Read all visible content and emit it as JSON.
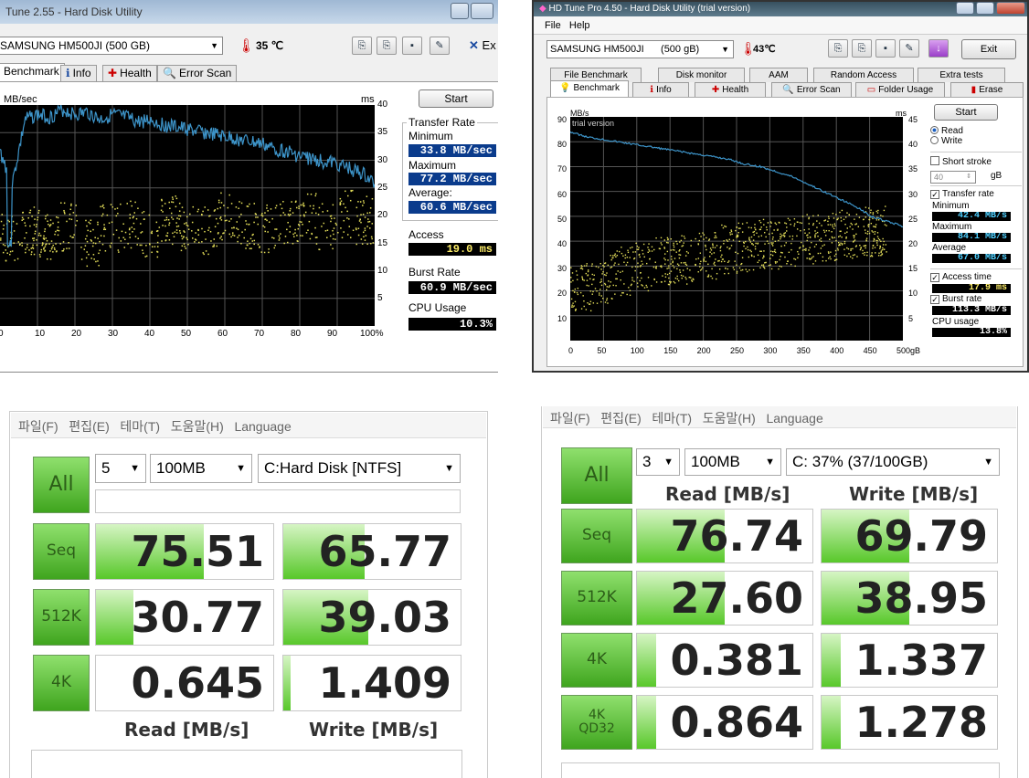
{
  "tl": {
    "title": "Tune 2.55 - Hard Disk Utility",
    "drive": "SAMSUNG HM500JI (500 GB)",
    "temp": "35 ℃",
    "exit": "Ex",
    "tabs": [
      "Benchmark",
      "Info",
      "Health",
      "Error Scan"
    ],
    "start": "Start",
    "yunit": "MB/sec",
    "msunit": "ms",
    "yticks": [
      "40",
      "35",
      "30",
      "25",
      "20",
      "15",
      "10",
      "5"
    ],
    "xticks": [
      "0",
      "10",
      "20",
      "30",
      "40",
      "50",
      "60",
      "70",
      "80",
      "90",
      "100%"
    ],
    "transfer": "Transfer Rate",
    "min_l": "Minimum",
    "min": "33.8 MB/sec",
    "max_l": "Maximum",
    "max": "77.2 MB/sec",
    "avg_l": "Average:",
    "avg": "60.6 MB/sec",
    "access_l": "Access",
    "access": "19.0 ms",
    "burst_l": "Burst Rate",
    "burst": "60.9 MB/sec",
    "cpu_l": "CPU Usage",
    "cpu": "10.3%",
    "read_curve": [
      71,
      58,
      84,
      86,
      85,
      88,
      86,
      87,
      84,
      86,
      85,
      83,
      84,
      82,
      81,
      80,
      79,
      78,
      77,
      76,
      75,
      74,
      72,
      71,
      69,
      68,
      67,
      66,
      64,
      62,
      58
    ],
    "access_dots": [
      32,
      35,
      33,
      37,
      30,
      36,
      38,
      34,
      40,
      37,
      35,
      42,
      38,
      36,
      39,
      41,
      37,
      43,
      40
    ]
  },
  "tr": {
    "title": "HD Tune Pro 4.50 - Hard Disk Utility (trial version)",
    "menu": [
      "File",
      "Help"
    ],
    "drive": "SAMSUNG HM500JI      (500 gB)",
    "temp": "43℃",
    "exit": "Exit",
    "tabs_top": [
      "File Benchmark",
      "Disk monitor",
      "AAM",
      "Random Access",
      "Extra tests"
    ],
    "tabs_bottom": [
      "Benchmark",
      "Info",
      "Health",
      "Error Scan",
      "Folder Usage",
      "Erase"
    ],
    "start": "Start",
    "trial": "trial version",
    "yunit": "MB/s",
    "msunit": "ms",
    "yticks": [
      "90",
      "80",
      "70",
      "60",
      "50",
      "40",
      "30",
      "20",
      "10"
    ],
    "msticks": [
      "45",
      "40",
      "35",
      "30",
      "25",
      "20",
      "15",
      "10",
      "5"
    ],
    "xticks": [
      "0",
      "50",
      "100",
      "150",
      "200",
      "250",
      "300",
      "350",
      "400",
      "450",
      "500gB"
    ],
    "read": "Read",
    "write": "Write",
    "short": "Short stroke",
    "short_val": "40",
    "gb": "gB",
    "transfer": "Transfer rate",
    "min_l": "Minimum",
    "min": "42.4 MB/s",
    "max_l": "Maximum",
    "max": "84.1 MB/s",
    "avg_l": "Average",
    "avg": "67.0 MB/s",
    "access_l": "Access time",
    "access": "17.9 ms",
    "burst_l": "Burst rate",
    "burst": "113.3 MB/s",
    "cpu_l": "CPU usage",
    "cpu": "13.8%",
    "read_curve": [
      84,
      82,
      81,
      80,
      79,
      78,
      77,
      76,
      75,
      74,
      73,
      71,
      70,
      68,
      66,
      63,
      60,
      57,
      54,
      50,
      48,
      46
    ],
    "access_dots": [
      22,
      25,
      28,
      30,
      32,
      33,
      35,
      37,
      38,
      39,
      40,
      41,
      42,
      43,
      44,
      45
    ]
  },
  "bl": {
    "menu": "파일(F)   편집(E)   테마(T)   도움말(H)   Language",
    "count": "5",
    "size": "100MB",
    "drive": "C:Hard Disk [NTFS]",
    "all": "All",
    "rows": [
      {
        "label": "Seq",
        "read": "75.51",
        "write": "65.77",
        "rfill": 0.61,
        "wfill": 0.46
      },
      {
        "label": "512K",
        "read": "30.77",
        "write": "39.03",
        "rfill": 0.21,
        "wfill": 0.48
      },
      {
        "label": "4K",
        "read": "0.645",
        "write": "1.409",
        "rfill": 0.0,
        "wfill": 0.04
      }
    ],
    "read_h": "Read [MB/s]",
    "write_h": "Write [MB/s]"
  },
  "br": {
    "menu": "파일(F)   편집(E)   테마(T)   도움말(H)   Language",
    "count": "3",
    "size": "100MB",
    "drive": "C: 37% (37/100GB)",
    "all": "All",
    "read_h": "Read [MB/s]",
    "write_h": "Write [MB/s]",
    "rows": [
      {
        "label": "Seq",
        "read": "76.74",
        "write": "69.79",
        "rfill": 0.5,
        "wfill": 0.5
      },
      {
        "label": "512K",
        "read": "27.60",
        "write": "38.95",
        "rfill": 0.5,
        "wfill": 0.5
      },
      {
        "label": "4K",
        "read": "0.381",
        "write": "1.337",
        "rfill": 0.11,
        "wfill": 0.11
      },
      {
        "label": "4K\nQD32",
        "read": "0.864",
        "write": "1.278",
        "rfill": 0.11,
        "wfill": 0.11
      }
    ]
  },
  "colors": {
    "curve": "#3d94c9",
    "dots": "#e6e05a",
    "grid": "#555",
    "green": "#58c82a"
  }
}
